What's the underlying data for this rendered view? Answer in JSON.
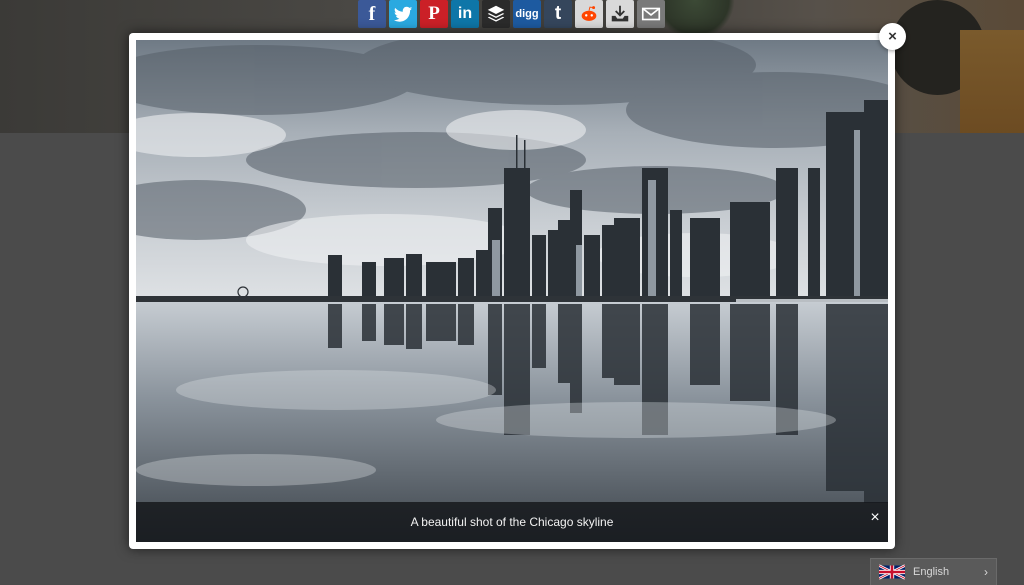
{
  "share_bar": {
    "buttons": [
      {
        "icon": "facebook-icon",
        "label": "f",
        "color": "#3b5998"
      },
      {
        "icon": "twitter-icon",
        "label": "",
        "color": "#2aa9e0"
      },
      {
        "icon": "pinterest-icon",
        "label": "P",
        "color": "#cb2027"
      },
      {
        "icon": "linkedin-icon",
        "label": "in",
        "color": "#0e76a8"
      },
      {
        "icon": "buffer-icon",
        "label": "",
        "color": "#2b2b2b"
      },
      {
        "icon": "digg-icon",
        "label": "digg",
        "color": "#1d5aa0"
      },
      {
        "icon": "tumblr-icon",
        "label": "t",
        "color": "#35465c"
      },
      {
        "icon": "reddit-icon",
        "label": "",
        "color": "#d9d9d9"
      },
      {
        "icon": "download-icon",
        "label": "",
        "color": "#d9d9d9"
      },
      {
        "icon": "email-icon",
        "label": "",
        "color": "#7a7a7a"
      }
    ]
  },
  "lightbox": {
    "caption": "A beautiful shot of the Chicago skyline",
    "caption_close": "×",
    "close": "×"
  },
  "language": {
    "label": "English",
    "icon": "uk-flag-icon",
    "chevron": "›"
  }
}
